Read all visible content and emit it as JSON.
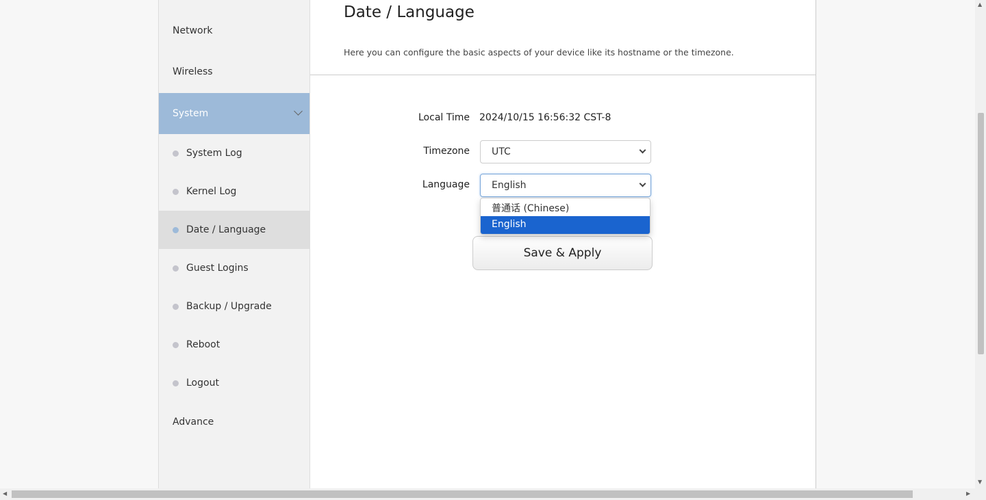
{
  "sidebar": {
    "items": [
      {
        "label": "Network"
      },
      {
        "label": "Wireless"
      },
      {
        "label": "System"
      },
      {
        "label": "System Log"
      },
      {
        "label": "Kernel Log"
      },
      {
        "label": "Date / Language"
      },
      {
        "label": "Guest Logins"
      },
      {
        "label": "Backup / Upgrade"
      },
      {
        "label": "Reboot"
      },
      {
        "label": "Logout"
      },
      {
        "label": "Advance"
      }
    ]
  },
  "main": {
    "title": "Date / Language",
    "description": "Here you can configure the basic aspects of your device like its hostname or the timezone.",
    "local_time_label": "Local Time",
    "local_time_value": "2024/10/15 16:56:32 CST-8",
    "timezone_label": "Timezone",
    "timezone_value": "UTC",
    "language_label": "Language",
    "language_value": "English",
    "language_options": [
      "普通话 (Chinese)",
      "English"
    ],
    "save_label": "Save & Apply"
  },
  "colors": {
    "accent": "#9dbad9",
    "selected_option": "#1a64cf"
  }
}
